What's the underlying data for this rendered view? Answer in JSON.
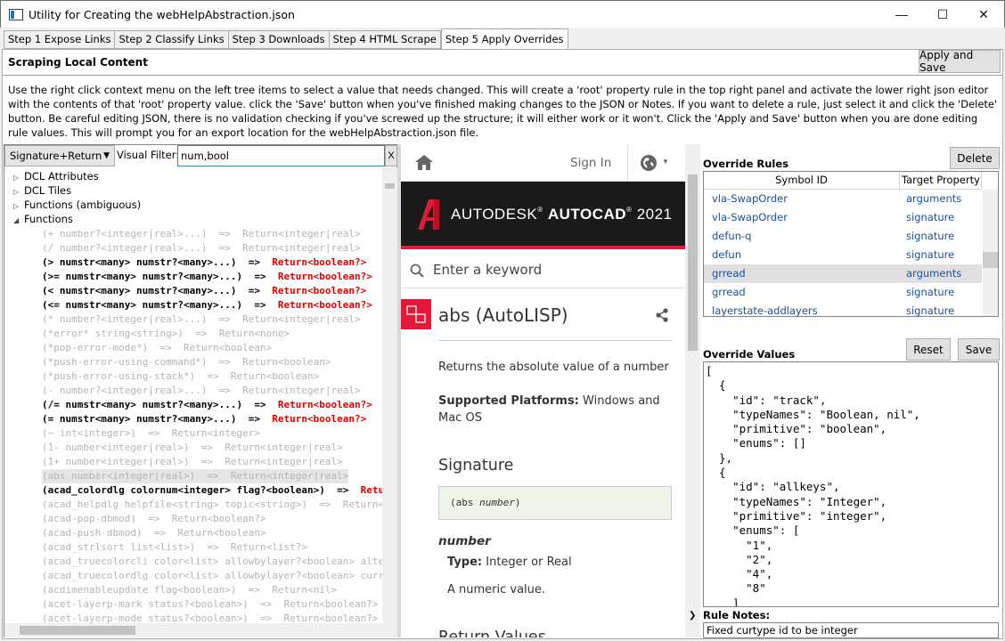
{
  "window": {
    "title": "Utility for Creating the webHelpAbstraction.json",
    "minimize": "—",
    "maximize": "☐",
    "close": "✕"
  },
  "tabs": [
    {
      "label": "Step 1 Expose Links"
    },
    {
      "label": "Step 2 Classify Links"
    },
    {
      "label": "Step 3 Downloads"
    },
    {
      "label": "Step 4 HTML Scrape"
    },
    {
      "label": "Step 5 Apply Overrides",
      "active": true
    }
  ],
  "header": {
    "section_title": "Scraping Local Content",
    "apply_save_label": "Apply and Save",
    "instructions": "Use the right click context menu on the left tree items to select a value that needs changed. This will create a 'root' property rule in the top right panel and activate the lower right json editor with the contents of that 'root' property value. click the 'Save' button when you've finished making changes to the JSON or Notes. If you want to delete a rule, just select it and click the 'Delete' button. Be careful editing JSON, there is no validation checking if you've screwed up the structure; it will either work or it won't. Click the 'Apply and Save' button when you are done editing rule values. This will prompt you for an export location for the webHelpAbstraction.json file."
  },
  "left": {
    "mode_select": "Signature+Return",
    "filter_label": "Visual Filter:",
    "filter_value": "num,bool",
    "clear_label": "X",
    "tree_nodes": [
      {
        "label": "DCL Attributes",
        "expanded": false
      },
      {
        "label": "DCL Tiles",
        "expanded": false
      },
      {
        "label": "Functions (ambiguous)",
        "expanded": false
      },
      {
        "label": "Functions",
        "expanded": true
      }
    ],
    "functions": [
      {
        "sig": "(+ number?<integer|real>...)  =>  ",
        "ret": "Return<integer|real>",
        "hl": false
      },
      {
        "sig": "(/ number?<integer|real>...)  =>  ",
        "ret": "Return<integer|real>",
        "hl": false
      },
      {
        "sig": "(> numstr<many> numstr?<many>...)  =>  ",
        "ret": "Return<boolean?>",
        "hl": true
      },
      {
        "sig": "(>= numstr<many> numstr?<many>...)  =>  ",
        "ret": "Return<boolean?>",
        "hl": true
      },
      {
        "sig": "(< numstr<many> numstr?<many>...)  =>  ",
        "ret": "Return<boolean?>",
        "hl": true
      },
      {
        "sig": "(<= numstr<many> numstr?<many>...)  =>  ",
        "ret": "Return<boolean?>",
        "hl": true
      },
      {
        "sig": "(* number?<integer|real>...)  =>  ",
        "ret": "Return<integer|real>",
        "hl": false
      },
      {
        "sig": "(*error* string<string>)  =>  ",
        "ret": "Return<none>",
        "hl": false
      },
      {
        "sig": "(*pop-error-mode*)  =>  ",
        "ret": "Return<boolean>",
        "hl": false
      },
      {
        "sig": "(*push-error-using-command*)  =>  ",
        "ret": "Return<boolean>",
        "hl": false
      },
      {
        "sig": "(*push-error-using-stack*)  =>  ",
        "ret": "Return<boolean>",
        "hl": false
      },
      {
        "sig": "(- number?<integer|real>...)  =>  ",
        "ret": "Return<integer|real>",
        "hl": false
      },
      {
        "sig": "(/= numstr<many> numstr?<many>...)  =>  ",
        "ret": "Return<boolean?>",
        "hl": true
      },
      {
        "sig": "(= numstr<many> numstr?<many>...)  =>  ",
        "ret": "Return<boolean?>",
        "hl": true
      },
      {
        "sig": "(~ int<integer>)  =>  ",
        "ret": "Return<integer>",
        "hl": false
      },
      {
        "sig": "(1- number<integer|real>)  =>  ",
        "ret": "Return<integer|real>",
        "hl": false
      },
      {
        "sig": "(1+ number<integer|real>)  =>  ",
        "ret": "Return<integer|real>",
        "hl": false
      },
      {
        "sig": "(abs number<integer|real>)  =>  ",
        "ret": "Return<integer|real>",
        "hl": false,
        "sel": true
      },
      {
        "sig": "(acad_colordlg colornum<integer> flag?<boolean>)  =>  ",
        "ret": "Return<integer|nil>",
        "hl": true
      },
      {
        "sig": "(acad_helpdlg helpfile<string> topic<string>)  =>  ",
        "ret": "Return<none>",
        "hl": false
      },
      {
        "sig": "(acad-pop-dbmod)  =>  ",
        "ret": "Return<boolean?>",
        "hl": false
      },
      {
        "sig": "(acad-push-dbmod)  =>  ",
        "ret": "Return<boolean>",
        "hl": false
      },
      {
        "sig": "(acad_strlsort list<list>)  =>  ",
        "ret": "Return<list?>",
        "hl": false
      },
      {
        "sig": "(acad_truecolorcli color<list> allowbylayer?<boolean> alternateTitle?<string>)",
        "ret": "",
        "hl": false
      },
      {
        "sig": "(acad_truecolordlg color<list> allowbylayer?<boolean> currentLayerColor?<list>)",
        "ret": "",
        "hl": false
      },
      {
        "sig": "(acdimenableupdate flag<boolean>)  =>  ",
        "ret": "Return<nil>",
        "hl": false
      },
      {
        "sig": "(acet-layerp-mark status?<boolean>)  =>  ",
        "ret": "Return<boolean?>",
        "hl": false
      },
      {
        "sig": "(acet-layerp-mode status?<boolean>)  =>  ",
        "ret": "Return<boolean?>",
        "hl": false
      }
    ]
  },
  "help": {
    "sign_in": "Sign In",
    "brand_left": "AUTODESK",
    "brand_reg": "®",
    "brand_right": "AUTOCAD",
    "brand_year": "2021",
    "search_placeholder": "Enter a keyword",
    "doc_title": "abs (AutoLISP)",
    "summary": "Returns the absolute value of a number",
    "platforms_label": "Supported Platforms:",
    "platforms_value": "Windows and",
    "platforms_value2": "Mac OS",
    "signature_heading": "Signature",
    "signature_code_open": "(abs ",
    "signature_code_arg": "number",
    "signature_code_close": ")",
    "param_name": "number",
    "type_label": "Type:",
    "type_value": "Integer or Real",
    "param_desc": "A numeric value.",
    "return_heading": "Return Values"
  },
  "right": {
    "override_rules_label": "Override Rules",
    "delete_label": "Delete",
    "col_symbol": "Symbol ID",
    "col_target": "Target Property",
    "rules": [
      {
        "symbol": "vla-SwapOrder",
        "target": "arguments"
      },
      {
        "symbol": "vla-SwapOrder",
        "target": "signature"
      },
      {
        "symbol": "defun-q",
        "target": "signature"
      },
      {
        "symbol": "defun",
        "target": "signature"
      },
      {
        "symbol": "grread",
        "target": "arguments",
        "selected": true
      },
      {
        "symbol": "grread",
        "target": "signature"
      },
      {
        "symbol": "layerstate-addlayers",
        "target": "signature"
      }
    ],
    "override_values_label": "Override Values",
    "reset_label": "Reset",
    "save_label": "Save",
    "json_text": "[\n  {\n    \"id\": \"track\",\n    \"typeNames\": \"Boolean, nil\",\n    \"primitive\": \"boolean\",\n    \"enums\": []\n  },\n  {\n    \"id\": \"allkeys\",\n    \"typeNames\": \"Integer\",\n    \"primitive\": \"integer\",\n    \"enums\": [\n      \"1\",\n      \"2\",\n      \"4\",\n      \"8\"\n    ]",
    "rule_notes_label": "Rule Notes:",
    "rule_notes_value": "Fixed curtype id to be integer"
  },
  "colors": {
    "accent_red": "#e51937",
    "link_blue": "#1a50a0",
    "return_red": "#e00000"
  }
}
